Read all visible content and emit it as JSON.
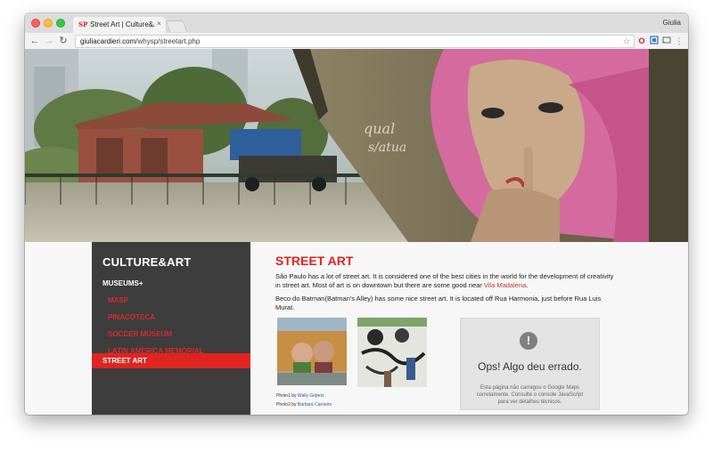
{
  "browser": {
    "tab_title": "Street Art | Culture&Art | Why",
    "tab_favicon": "SP",
    "tab_close": "×",
    "user": "Giulia",
    "url_host": "giuliacardieri.com",
    "url_path": "/whysp/streetart.php",
    "icons": [
      "back-icon",
      "forward-icon",
      "reload-icon",
      "star-icon",
      "opera-icon",
      "extension-icon",
      "cast-icon",
      "menu-icon"
    ]
  },
  "sidebar": {
    "brand": "CULTURE&ART",
    "section": "MUSEUMS+",
    "items": [
      {
        "label": "MASP"
      },
      {
        "label": "PINACOTECA"
      },
      {
        "label": "SOCCER MUSEUM"
      },
      {
        "label": "LATIN AMERICA MEMORIAL"
      }
    ],
    "active": "STREET ART"
  },
  "main": {
    "title": "STREET ART",
    "para1": "São Paulo has a lot of street art. It is considered one of the best cities in the world for the development of creativity in street art. Most of art is on downtown but there are some good near",
    "para1_link": "Vila Madalena",
    "para1_end": ".",
    "para2": "Beco do Batman(Batman's Alley) has some nice street art. It is located off Rua Harmonia, just before Rua Luis Murat.",
    "caption1_prefix": "Photo1 by",
    "caption1_link": "Wally Gobetz",
    "caption2_prefix": "Photo2 by",
    "caption2_link": "Barbara Carneiro"
  },
  "map": {
    "icon": "!",
    "error_title": "Ops! Algo deu errado.",
    "error_desc": "Esta página não carregou o Google Maps corretamente. Consulte o console JavaScript para ver detalhes técnicos."
  },
  "colors": {
    "accent": "#e0241f",
    "sidebar_bg": "#3d3d3d"
  }
}
